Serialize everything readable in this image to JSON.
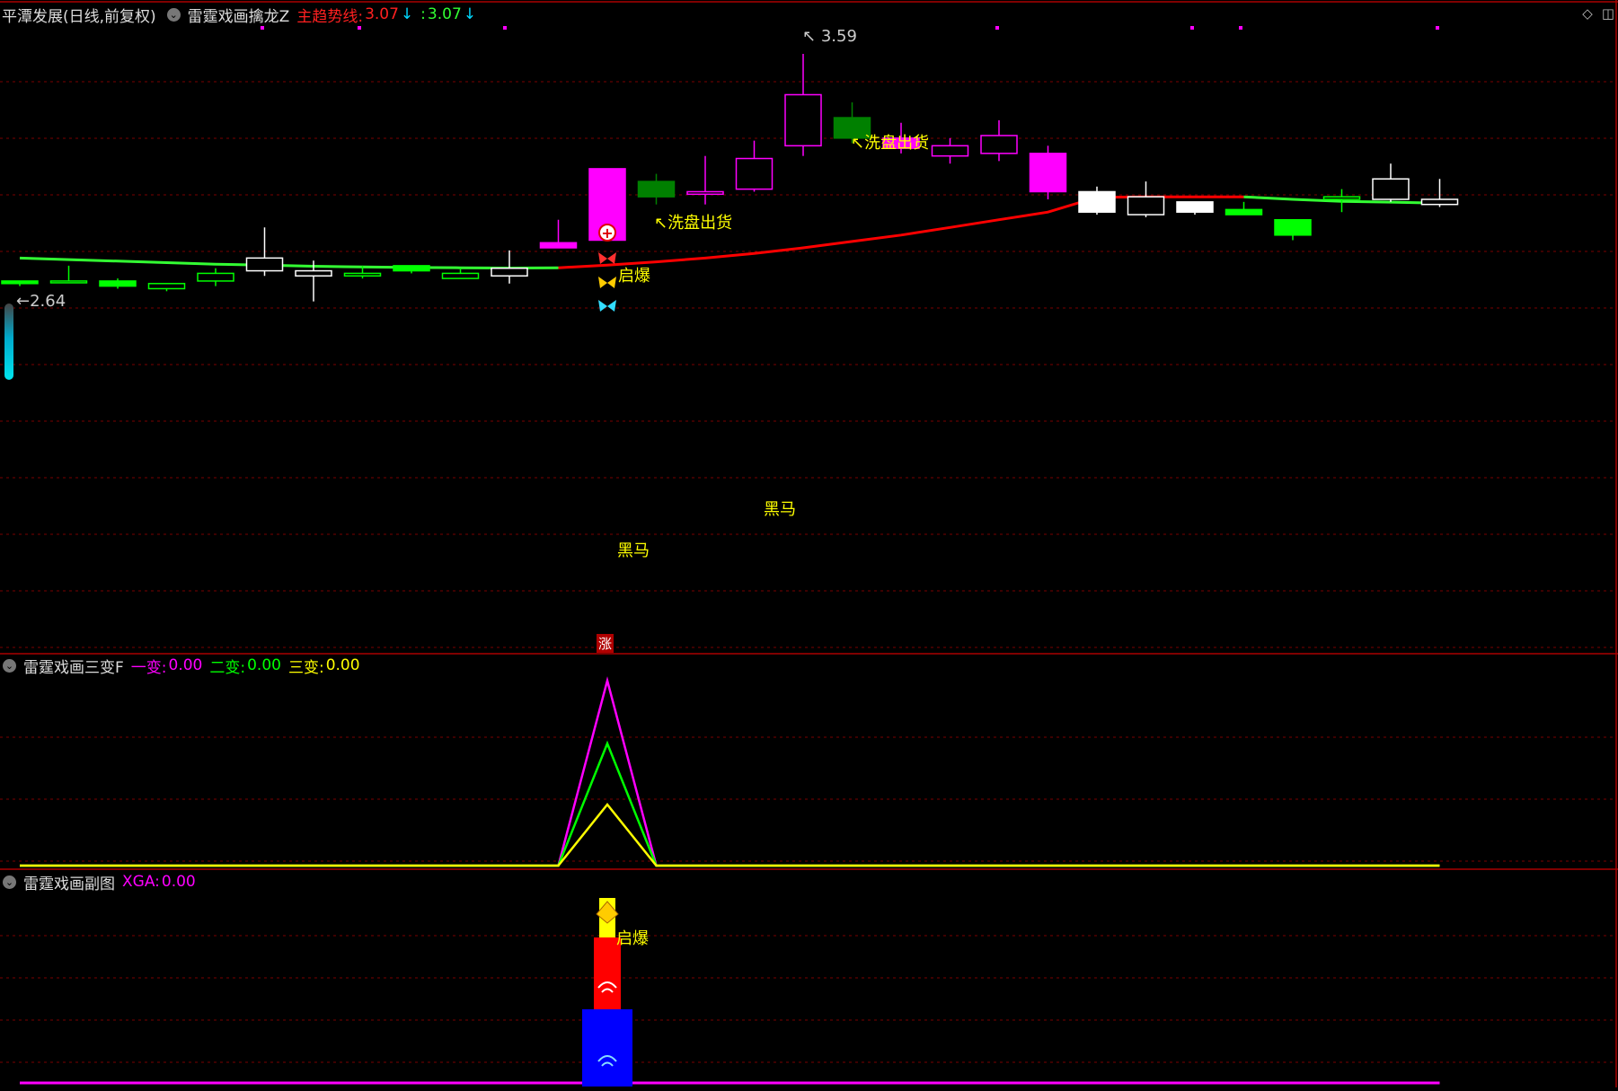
{
  "main_header": {
    "title": "平潭发展(日线,前复权)",
    "indicator_name": "雷霆戏画擒龙Z",
    "trend_label": "主趋势线:",
    "trend_value": "3.07",
    "second_label": ":",
    "second_value": "3.07"
  },
  "sub1_header": {
    "indicator_name": "雷霆戏画三变F",
    "a_label": "一变:",
    "a_value": "0.00",
    "b_label": "二变:",
    "b_value": "0.00",
    "c_label": "三变:",
    "c_value": "0.00"
  },
  "sub2_header": {
    "indicator_name": "雷霆戏画副图",
    "a_label": "XGA:",
    "a_value": "0.00"
  },
  "annotations": {
    "high_label": "3.59",
    "low_label": "2.64",
    "wash1": "洗盘出货",
    "wash2": "洗盘出货",
    "qibao": "启爆",
    "heima1": "黑马",
    "heima2": "黑马",
    "zhang": "涨",
    "qibao_sub": "启爆"
  },
  "colors": {
    "up": "#ff00ff",
    "down_green": "#00ff00",
    "dark_green": "#008000",
    "white": "#ffffff",
    "trend_red": "#ff0000",
    "trend_green": "#33ff33",
    "yellow": "#ffff00",
    "magenta": "#ff00ff",
    "green": "#00ff00",
    "blue": "#0000ff",
    "grid": "#7a0000"
  },
  "chart_data": {
    "type": "candlestick",
    "high": 3.59,
    "low": 2.64,
    "candles": [
      {
        "o": 2.7,
        "c": 2.69,
        "h": 2.7,
        "l": 2.68,
        "color": "down_green",
        "fill": true
      },
      {
        "o": 2.7,
        "c": 2.7,
        "h": 2.76,
        "l": 2.7,
        "color": "down_green",
        "fill": false
      },
      {
        "o": 2.7,
        "c": 2.68,
        "h": 2.71,
        "l": 2.67,
        "color": "down_green",
        "fill": true
      },
      {
        "o": 2.67,
        "c": 2.69,
        "h": 2.69,
        "l": 2.66,
        "color": "down_green",
        "fill": false
      },
      {
        "o": 2.7,
        "c": 2.73,
        "h": 2.75,
        "l": 2.68,
        "color": "down_green",
        "fill": false
      },
      {
        "o": 2.74,
        "c": 2.79,
        "h": 2.91,
        "l": 2.72,
        "color": "white",
        "fill": false
      },
      {
        "o": 2.72,
        "c": 2.74,
        "h": 2.78,
        "l": 2.62,
        "color": "white",
        "fill": false
      },
      {
        "o": 2.73,
        "c": 2.72,
        "h": 2.76,
        "l": 2.71,
        "color": "down_green",
        "fill": false
      },
      {
        "o": 2.74,
        "c": 2.76,
        "h": 2.76,
        "l": 2.73,
        "color": "down_green",
        "fill": true
      },
      {
        "o": 2.71,
        "c": 2.73,
        "h": 2.75,
        "l": 2.71,
        "color": "down_green",
        "fill": false
      },
      {
        "o": 2.72,
        "c": 2.75,
        "h": 2.82,
        "l": 2.69,
        "color": "white",
        "fill": false
      },
      {
        "o": 2.83,
        "c": 2.85,
        "h": 2.94,
        "l": 2.83,
        "color": "up",
        "fill": true
      },
      {
        "o": 2.86,
        "c": 3.14,
        "h": 3.14,
        "l": 2.86,
        "color": "up",
        "fill": true
      },
      {
        "o": 3.09,
        "c": 3.03,
        "h": 3.12,
        "l": 3.0,
        "color": "dark_green",
        "fill": true
      },
      {
        "o": 3.04,
        "c": 3.05,
        "h": 3.19,
        "l": 3.0,
        "color": "up",
        "fill": false
      },
      {
        "o": 3.06,
        "c": 3.18,
        "h": 3.25,
        "l": 3.05,
        "color": "up",
        "fill": false
      },
      {
        "o": 3.23,
        "c": 3.43,
        "h": 3.59,
        "l": 3.19,
        "color": "up",
        "fill": false
      },
      {
        "o": 3.34,
        "c": 3.26,
        "h": 3.4,
        "l": 3.24,
        "color": "dark_green",
        "fill": true
      },
      {
        "o": 3.22,
        "c": 3.26,
        "h": 3.32,
        "l": 3.2,
        "color": "up",
        "fill": true
      },
      {
        "o": 3.19,
        "c": 3.23,
        "h": 3.26,
        "l": 3.16,
        "color": "up",
        "fill": false
      },
      {
        "o": 3.2,
        "c": 3.27,
        "h": 3.33,
        "l": 3.17,
        "color": "up",
        "fill": false
      },
      {
        "o": 3.05,
        "c": 3.2,
        "h": 3.23,
        "l": 3.02,
        "color": "up",
        "fill": true
      },
      {
        "o": 3.05,
        "c": 2.97,
        "h": 3.07,
        "l": 2.96,
        "color": "white",
        "fill": true
      },
      {
        "o": 2.96,
        "c": 3.03,
        "h": 3.09,
        "l": 2.95,
        "color": "white",
        "fill": false
      },
      {
        "o": 3.01,
        "c": 2.97,
        "h": 3.01,
        "l": 2.96,
        "color": "white",
        "fill": true
      },
      {
        "o": 2.98,
        "c": 2.96,
        "h": 3.01,
        "l": 2.96,
        "color": "down_green",
        "fill": true
      },
      {
        "o": 2.94,
        "c": 2.88,
        "h": 2.94,
        "l": 2.86,
        "color": "down_green",
        "fill": true
      },
      {
        "o": 3.03,
        "c": 3.02,
        "h": 3.06,
        "l": 2.97,
        "color": "down_green",
        "fill": false
      },
      {
        "o": 3.02,
        "c": 3.1,
        "h": 3.16,
        "l": 3.01,
        "color": "white",
        "fill": false
      },
      {
        "o": 3.02,
        "c": 3.0,
        "h": 3.1,
        "l": 2.99,
        "color": "white",
        "fill": false
      }
    ],
    "trend_line": [
      2.79,
      2.784,
      2.778,
      2.772,
      2.766,
      2.762,
      2.758,
      2.755,
      2.753,
      2.752,
      2.751,
      2.752,
      2.762,
      2.775,
      2.79,
      2.808,
      2.83,
      2.855,
      2.88,
      2.91,
      2.94,
      2.97,
      3.028,
      3.03,
      3.03,
      3.03,
      3.02,
      3.012,
      3.009,
      3.005
    ],
    "trend_red_range": [
      11,
      25
    ],
    "sub1": {
      "one": [
        0,
        0,
        0,
        0,
        0,
        0,
        0,
        0,
        0,
        0,
        0,
        0,
        1.0,
        0,
        0,
        0,
        0,
        0,
        0,
        0,
        0,
        0,
        0,
        0,
        0,
        0,
        0,
        0,
        0,
        0
      ],
      "two": [
        0,
        0,
        0,
        0,
        0,
        0,
        0,
        0,
        0,
        0,
        0,
        0,
        0.66,
        0,
        0,
        0,
        0,
        0,
        0,
        0,
        0,
        0,
        0,
        0,
        0,
        0,
        0,
        0,
        0,
        0
      ],
      "three": [
        0,
        0,
        0,
        0,
        0,
        0,
        0,
        0,
        0,
        0,
        0,
        0,
        0.33,
        0,
        0,
        0,
        0,
        0,
        0,
        0,
        0,
        0,
        0,
        0,
        0,
        0,
        0,
        0,
        0,
        0
      ]
    }
  }
}
